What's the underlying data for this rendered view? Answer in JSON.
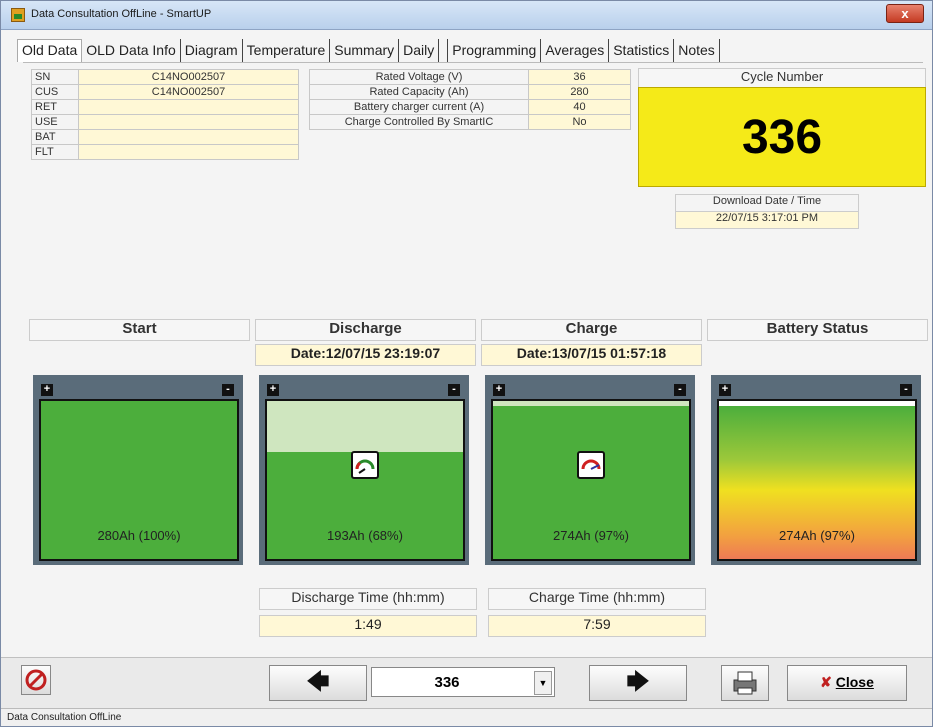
{
  "window": {
    "title": "Data Consultation OffLine - SmartUP",
    "close_glyph": "x"
  },
  "tabs": [
    {
      "label": "Old Data"
    },
    {
      "label": "OLD Data Info"
    },
    {
      "label": "Diagram"
    },
    {
      "label": "Temperature"
    },
    {
      "label": "Summary"
    },
    {
      "label": "Daily"
    },
    {
      "label": "Programming"
    },
    {
      "label": "Averages"
    },
    {
      "label": "Statistics"
    },
    {
      "label": "Notes"
    }
  ],
  "ids": [
    {
      "label": "SN",
      "value": "C14NO002507"
    },
    {
      "label": "CUS",
      "value": "C14NO002507"
    },
    {
      "label": "RET",
      "value": ""
    },
    {
      "label": "USE",
      "value": ""
    },
    {
      "label": "BAT",
      "value": ""
    },
    {
      "label": "FLT",
      "value": ""
    }
  ],
  "ratings": [
    {
      "label": "Rated Voltage (V)",
      "value": "36"
    },
    {
      "label": "Rated Capacity (Ah)",
      "value": "280"
    },
    {
      "label": "Battery charger current (A)",
      "value": "40"
    },
    {
      "label": "Charge Controlled By SmartIC",
      "value": "No"
    }
  ],
  "cycle": {
    "label": "Cycle Number",
    "value": "336"
  },
  "download": {
    "label": "Download Date / Time",
    "value": "22/07/15 3:17:01 PM"
  },
  "columns": {
    "start": {
      "title": "Start",
      "level": "280Ah (100%)",
      "fill_fraction": 1.0
    },
    "discharge": {
      "title": "Discharge",
      "date": "Date:12/07/15 23:19:07",
      "level": "193Ah (68%)",
      "fill_fraction": 0.68
    },
    "charge": {
      "title": "Charge",
      "date": "Date:13/07/15 01:57:18",
      "level": "274Ah (97%)",
      "fill_fraction": 0.97
    },
    "status": {
      "title": "Battery Status",
      "level": "274Ah (97%)",
      "fill_fraction": 0.97
    }
  },
  "times": {
    "discharge": {
      "label": "Discharge Time (hh:mm)",
      "value": "1:49"
    },
    "charge": {
      "label": "Charge Time (hh:mm)",
      "value": "7:59"
    }
  },
  "bottom": {
    "selector_value": "336",
    "close_label": "Close"
  },
  "statusbar": "Data Consultation OffLine",
  "colors": {
    "cycle_bg": "#f5ea18",
    "battery_green": "#4cae3c",
    "battery_light": "#cfe6bf",
    "field_bg": "#fff8d6"
  },
  "icons": [
    "app-icon",
    "no-record-icon",
    "left-arrow-icon",
    "right-arrow-icon",
    "printer-icon",
    "gauge-icon"
  ]
}
